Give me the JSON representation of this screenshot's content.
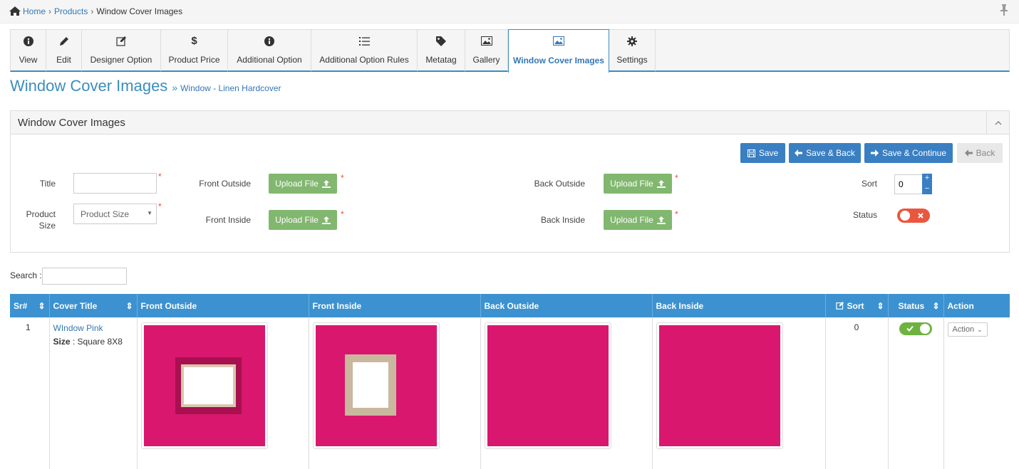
{
  "breadcrumb": {
    "home": "Home",
    "products": "Products",
    "current": "Window Cover Images"
  },
  "tabs": [
    {
      "label": "View",
      "icon": "info-icon"
    },
    {
      "label": "Edit",
      "icon": "pencil-icon"
    },
    {
      "label": "Designer Option",
      "icon": "edit-icon"
    },
    {
      "label": "Product Price",
      "icon": "dollar-icon"
    },
    {
      "label": "Additional Option",
      "icon": "info-icon"
    },
    {
      "label": "Additional Option Rules",
      "icon": "list-icon"
    },
    {
      "label": "Metatag",
      "icon": "tag-icon"
    },
    {
      "label": "Gallery",
      "icon": "image-icon"
    },
    {
      "label": "Window Cover Images",
      "icon": "image-icon",
      "active": true
    },
    {
      "label": "Settings",
      "icon": "gear-icon"
    }
  ],
  "page": {
    "title": "Window Cover Images",
    "subtitle": "Window - Linen Hardcover"
  },
  "panel": {
    "title": "Window Cover Images"
  },
  "buttons": {
    "save": "Save",
    "save_back": "Save & Back",
    "save_continue": "Save & Continue",
    "back": "Back",
    "upload": "Upload File"
  },
  "form": {
    "title_label": "Title",
    "title_value": "",
    "product_size_label": "Product Size",
    "product_size_value": "Product Size",
    "front_outside_label": "Front Outside",
    "front_inside_label": "Front Inside",
    "back_outside_label": "Back Outside",
    "back_inside_label": "Back Inside",
    "sort_label": "Sort",
    "sort_value": "0",
    "status_label": "Status",
    "required_mark": "*"
  },
  "search": {
    "label": "Search :",
    "value": ""
  },
  "table": {
    "columns": [
      "Sr#",
      "Cover Title",
      "Front Outside",
      "Front Inside",
      "Back Outside",
      "Back Inside",
      "Sort",
      "Status",
      "Action"
    ],
    "rows": [
      {
        "sr": "1",
        "cover_title": "WIndow Pink",
        "size_label": "Size",
        "size_value": ": Square 8X8",
        "sort": "0",
        "status": "on",
        "action": "Action"
      }
    ]
  },
  "colors": {
    "primary": "#3c8dbc",
    "header": "#3c92d0",
    "upload_green": "#81b76f",
    "cover_pink": "#d9176f",
    "toggle_off": "#e9573f",
    "toggle_on": "#6db33f"
  }
}
